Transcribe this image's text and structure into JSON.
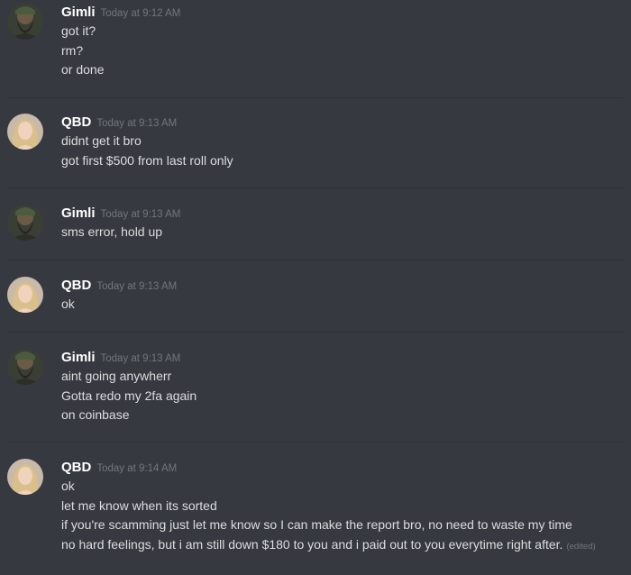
{
  "messages": [
    {
      "author": "Gimli",
      "timestamp": "Today at 9:12 AM",
      "lines": [
        "got it?",
        "rm?",
        "or done"
      ]
    },
    {
      "author": "QBD",
      "timestamp": "Today at 9:13 AM",
      "lines": [
        "didnt get it bro",
        "got first $500 from last roll only"
      ]
    },
    {
      "author": "Gimli",
      "timestamp": "Today at 9:13 AM",
      "lines": [
        "sms error, hold up"
      ]
    },
    {
      "author": "QBD",
      "timestamp": "Today at 9:13 AM",
      "lines": [
        "ok"
      ]
    },
    {
      "author": "Gimli",
      "timestamp": "Today at 9:13 AM",
      "lines": [
        "aint going anywherr",
        "Gotta redo my 2fa again",
        "on coinbase"
      ]
    },
    {
      "author": "QBD",
      "timestamp": "Today at 9:14 AM",
      "lines": [
        "ok",
        "let me know when its sorted",
        "if you're scamming just let me know so I can make the report bro, no need to waste my time",
        "no hard feelings, but i am still down $180 to you and i paid out to you everytime right after."
      ],
      "edited_label": "(edited)"
    }
  ],
  "colors": {
    "background": "#36393f",
    "divider": "#2f3136",
    "username": "#ffffff",
    "text": "#dcddde",
    "muted": "#72767d"
  },
  "icons": {
    "gimli_avatar": "bearded-man-avatar-icon",
    "qbd_avatar": "blonde-woman-avatar-icon"
  }
}
